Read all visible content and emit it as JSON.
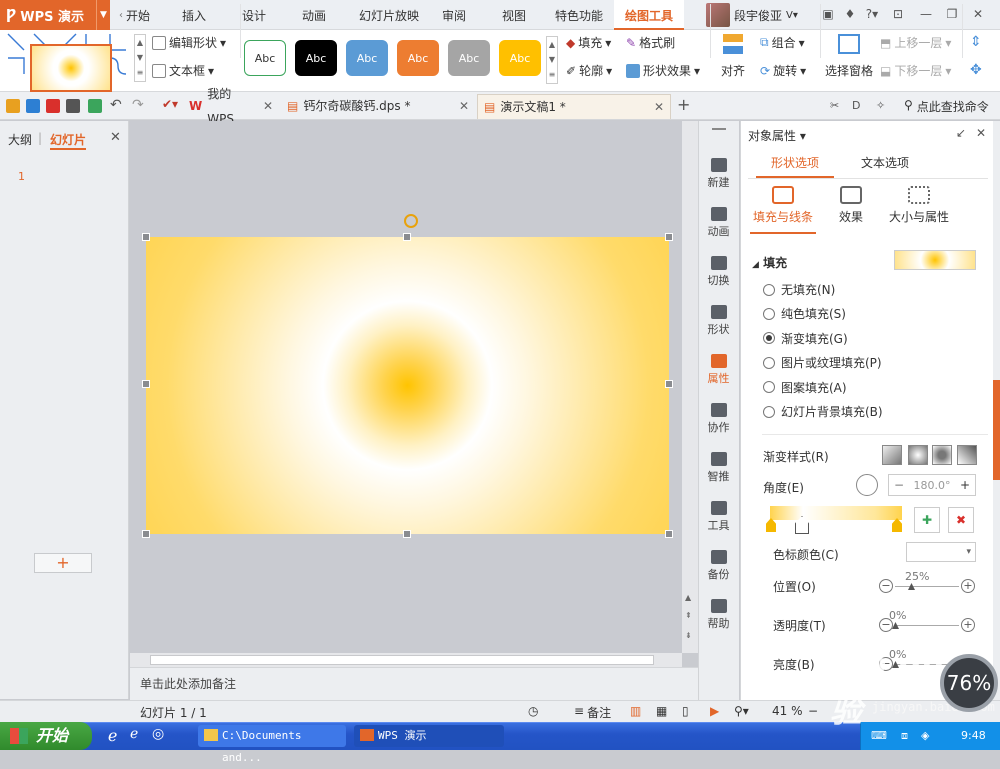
{
  "app": {
    "title": "WPS 演示"
  },
  "menu": {
    "tabs": [
      "开始",
      "插入",
      "设计",
      "动画",
      "幻灯片放映",
      "审阅",
      "视图",
      "特色功能",
      "绘图工具"
    ],
    "active": "绘图工具"
  },
  "user": {
    "name": "段宇俊亚"
  },
  "ribbon": {
    "edit_shape": "编辑形状",
    "textbox": "文本框",
    "style_label": "Abc",
    "fill": "填充",
    "format_painter": "格式刷",
    "outline": "轮廓",
    "shape_effect": "形状效果",
    "align": "对齐",
    "group": "组合",
    "rotate": "旋转",
    "selection_pane": "选择窗格",
    "bring_forward": "上移一层",
    "send_backward": "下移一层",
    "style_colors": [
      "#ffffff",
      "#000000",
      "#5b9bd5",
      "#ed7d31",
      "#a5a5a5",
      "#ffc000"
    ]
  },
  "doctabs": [
    {
      "label": "我的WPS"
    },
    {
      "label": "钙尔奇碳酸钙.dps *"
    },
    {
      "label": "演示文稿1 *"
    }
  ],
  "search": {
    "label": "点此查找命令"
  },
  "leftpanel": {
    "tab_outline": "大纲",
    "tab_slides": "幻灯片",
    "slide_num": "1",
    "add": "+"
  },
  "notes": {
    "placeholder": "单击此处添加备注"
  },
  "sidebar": {
    "items": [
      "新建",
      "动画",
      "切换",
      "形状",
      "属性",
      "协作",
      "智推",
      "工具",
      "备份",
      "帮助"
    ],
    "active": "属性"
  },
  "panel": {
    "title": "对象属性",
    "tab_shape": "形状选项",
    "tab_text": "文本选项",
    "sub_fill": "填充与线条",
    "sub_effect": "效果",
    "sub_size": "大小与属性",
    "section_fill": "填充",
    "options": [
      "无填充(N)",
      "纯色填充(S)",
      "渐变填充(G)",
      "图片或纹理填充(P)",
      "图案填充(A)",
      "幻灯片背景填充(B)"
    ],
    "selected_option": "渐变填充(G)",
    "gradient_style": "渐变样式(R)",
    "angle_label": "角度(E)",
    "angle_value": "180.0°",
    "stop_color": "色标颜色(C)",
    "position_label": "位置(O)",
    "position_value": "25%",
    "transparency_label": "透明度(T)",
    "transparency_value": "0%",
    "brightness_label": "亮度(B)",
    "brightness_value": "0%"
  },
  "status": {
    "slide_info": "幻灯片 1 / 1",
    "notes": "备注",
    "zoom": "41 %"
  },
  "taskbar": {
    "start": "开始",
    "items": [
      "C:\\Documents and...",
      "WPS 演示"
    ],
    "time": "9:48"
  },
  "watermark": {
    "text": "Bai du 经验",
    "sub": "jingyan.baidu.com",
    "gauge": "76%"
  }
}
